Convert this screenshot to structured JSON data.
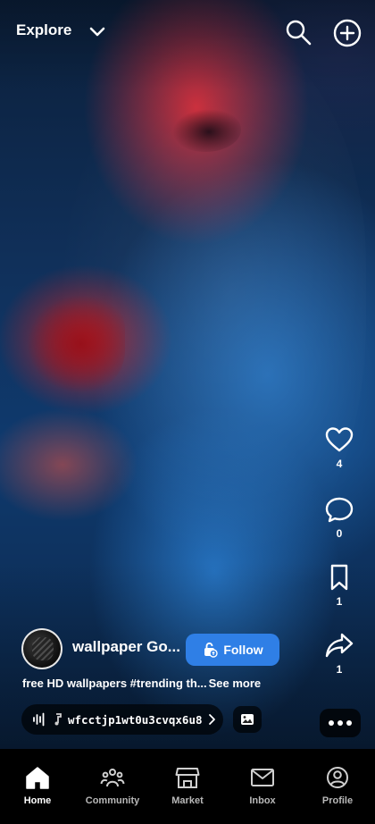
{
  "header": {
    "feed_label": "Explore",
    "icons": {
      "dropdown": "chevron-down-icon",
      "search": "search-icon",
      "create": "plus-circle-icon"
    }
  },
  "actions": {
    "like_count": "4",
    "comment_count": "0",
    "save_count": "1",
    "share_count": "1"
  },
  "post": {
    "author": "wallpaper Go...",
    "follow_label": "Follow",
    "caption": "free HD wallpapers #trending th...",
    "see_more": "See more",
    "sound_title": "wfcctjp1wt0u3cvqx6u8"
  },
  "nav": {
    "items": [
      {
        "label": "Home",
        "icon": "home-icon",
        "active": true
      },
      {
        "label": "Community",
        "icon": "community-icon"
      },
      {
        "label": "Market",
        "icon": "market-icon"
      },
      {
        "label": "Inbox",
        "icon": "mail-icon"
      },
      {
        "label": "Profile",
        "icon": "profile-icon"
      }
    ]
  },
  "colors": {
    "follow_button": "#2f7fe6",
    "nav_background": "#000000"
  }
}
